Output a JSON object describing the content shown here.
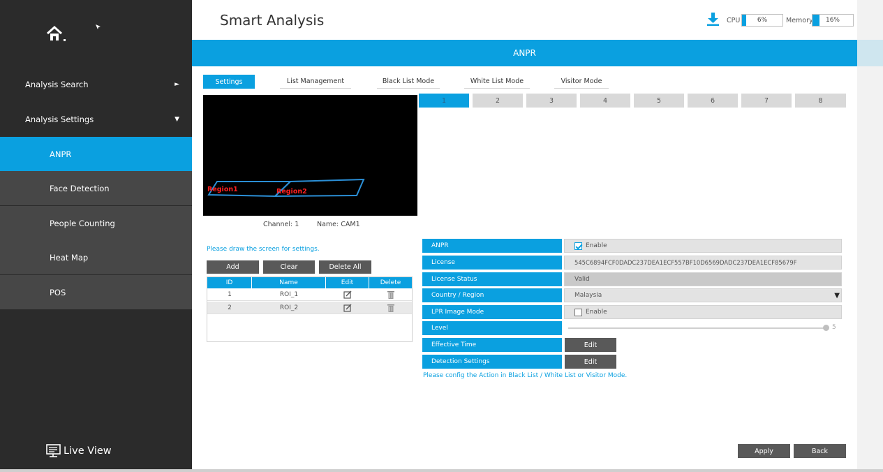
{
  "header": {
    "title": "Smart Analysis",
    "cpu_label": "CPU",
    "cpu_value": "6%",
    "memory_label": "Memory",
    "memory_value": "16%"
  },
  "banner": {
    "title": "ANPR"
  },
  "sidebar": {
    "items": [
      {
        "label": "Analysis Search",
        "arrow": "►"
      },
      {
        "label": "Analysis Settings",
        "arrow": "▼"
      },
      {
        "label": "ANPR"
      },
      {
        "label": "Face Detection"
      },
      {
        "label": "People Counting"
      },
      {
        "label": "Heat Map"
      },
      {
        "label": "POS"
      }
    ],
    "live_view": "Live View"
  },
  "tabs": [
    "Settings",
    "List Management",
    "Black List Mode",
    "White List Mode",
    "Visitor Mode"
  ],
  "channels": [
    "1",
    "2",
    "3",
    "4",
    "5",
    "6",
    "7",
    "8"
  ],
  "preview": {
    "region1": "Region1",
    "region2": "Region2",
    "channel": "Channel: 1",
    "name": "Name: CAM1"
  },
  "roi": {
    "hint": "Please draw the screen for settings.",
    "add": "Add",
    "clear": "Clear",
    "delete_all": "Delete All",
    "columns": [
      "ID",
      "Name",
      "Edit",
      "Delete"
    ],
    "rows": [
      {
        "id": "1",
        "name": "ROI_1"
      },
      {
        "id": "2",
        "name": "ROI_2"
      }
    ]
  },
  "form": {
    "anpr_label": "ANPR",
    "anpr_value": "Enable",
    "license_label": "License",
    "license_value": "545C6894FCF0DADC237DEA1ECF557BF10D6569DADC237DEA1ECF85679F",
    "license_status_label": "License Status",
    "license_status_value": "Valid",
    "country_label": "Country / Region",
    "country_value": "Malaysia",
    "lpr_label": "LPR Image Mode",
    "lpr_value": "Enable",
    "level_label": "Level",
    "level_value": "5",
    "effective_label": "Effective Time",
    "effective_btn": "Edit",
    "detection_label": "Detection Settings",
    "detection_btn": "Edit",
    "hint": "Please config the Action in Black List / White List or Visitor Mode."
  },
  "footer": {
    "apply": "Apply",
    "back": "Back"
  },
  "colors": {
    "accent": "#0aa0e0",
    "sidebar": "#2b2b2b",
    "button": "#595959"
  }
}
